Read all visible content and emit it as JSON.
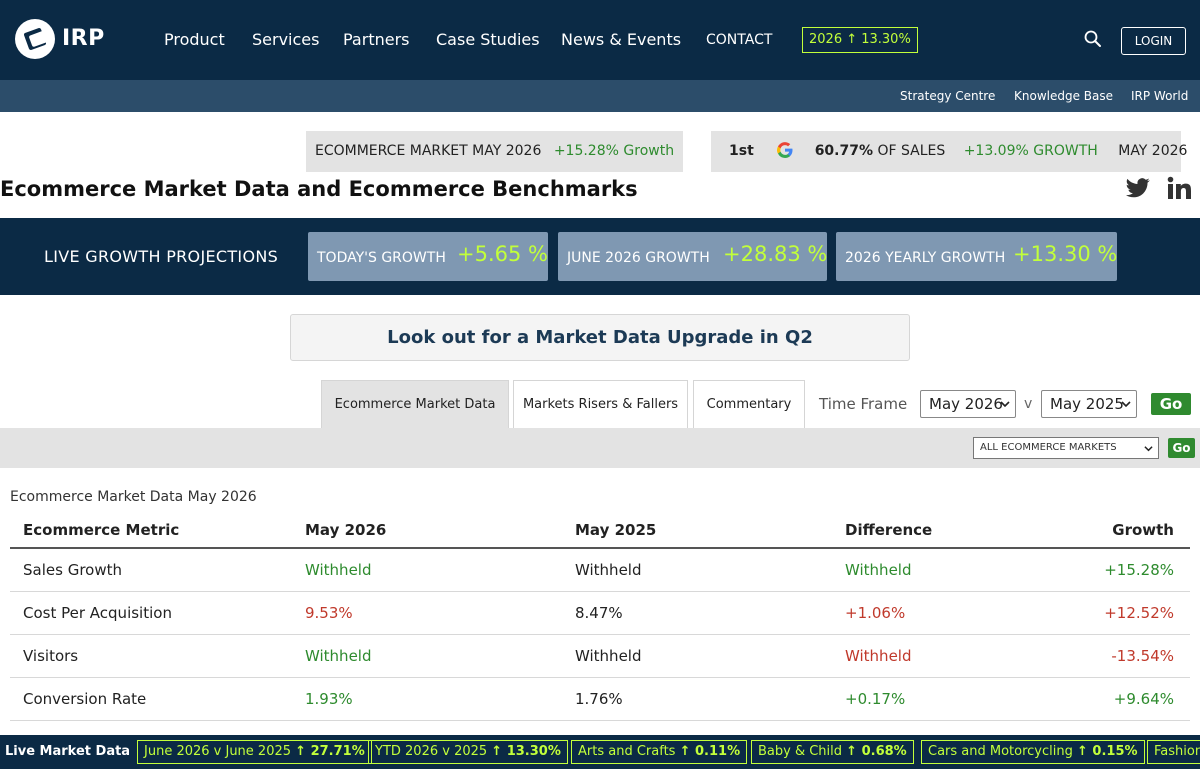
{
  "header": {
    "logo_text": "IRP",
    "nav": [
      "Product",
      "Services",
      "Partners",
      "Case Studies",
      "News & Events",
      "CONTACT"
    ],
    "growth_pill": "2026 ↑ 13.30%",
    "login_label": "LOGIN"
  },
  "subnav": [
    "Strategy Centre",
    "Knowledge Base",
    "IRP World"
  ],
  "market_box": {
    "label": "ECOMMERCE MARKET MAY 2026",
    "growth_value": "+15.28%",
    "growth_word": "Growth"
  },
  "google_box": {
    "rank": "1st",
    "share_value": "60.77%",
    "share_label": "OF SALES",
    "growth": "+13.09% GROWTH",
    "period": "MAY 2026"
  },
  "page_title": "Ecommerce Market Data and Ecommerce Benchmarks",
  "projections": {
    "label": "LIVE GROWTH PROJECTIONS",
    "items": [
      {
        "label": "TODAY'S GROWTH",
        "value": "+5.65 %"
      },
      {
        "label": "JUNE 2026 GROWTH",
        "value": "+28.83 %"
      },
      {
        "label": "2026 YEARLY GROWTH",
        "value": "+13.30 %"
      }
    ]
  },
  "upgrade_banner": "Look out for a Market Data Upgrade in Q2",
  "tabs": [
    "Ecommerce Market Data",
    "Markets Risers & Fallers",
    "Commentary"
  ],
  "timeframe": {
    "label": "Time Frame",
    "from": "May 2026",
    "separator": "v",
    "to": "May 2025",
    "go": "Go"
  },
  "filter": {
    "market_select": "ALL ECOMMERCE MARKETS",
    "go": "Go"
  },
  "table": {
    "caption": "Ecommerce Market Data May 2026",
    "headers": [
      "Ecommerce Metric",
      "May 2026",
      "May 2025",
      "Difference",
      "Growth"
    ],
    "rows": [
      [
        "Sales Growth",
        "Withheld",
        "Withheld",
        "Withheld",
        "+15.28%"
      ],
      [
        "Cost Per Acquisition",
        "9.53%",
        "8.47%",
        "+1.06%",
        "+12.52%"
      ],
      [
        "Visitors",
        "Withheld",
        "Withheld",
        "Withheld",
        "-13.54%"
      ],
      [
        "Conversion Rate",
        "1.93%",
        "1.76%",
        "+0.17%",
        "+9.64%"
      ]
    ]
  },
  "ticker": {
    "label": "Live Market Data",
    "items": [
      {
        "label": "June 2026 v June 2025",
        "value": "↑ 27.71%"
      },
      {
        "label": "YTD 2026 v 2025",
        "value": "↑ 13.30%"
      },
      {
        "label": "Arts and Crafts",
        "value": "↑ 0.11%"
      },
      {
        "label": "Baby & Child",
        "value": "↑ 0.68%"
      },
      {
        "label": "Cars and Motorcycling",
        "value": "↑ 0.15%"
      },
      {
        "label": "Fashion",
        "value": ""
      }
    ]
  },
  "colors": {
    "navy": "#0b2a45",
    "accent_lime": "#c2ff3a",
    "positive": "#2e8b2e",
    "negative": "#c0392b",
    "go_green": "#2f8a2f"
  },
  "icons": [
    "irp-logo",
    "search-icon",
    "google-icon",
    "twitter-icon",
    "linkedin-icon",
    "chevron-down-icon"
  ]
}
